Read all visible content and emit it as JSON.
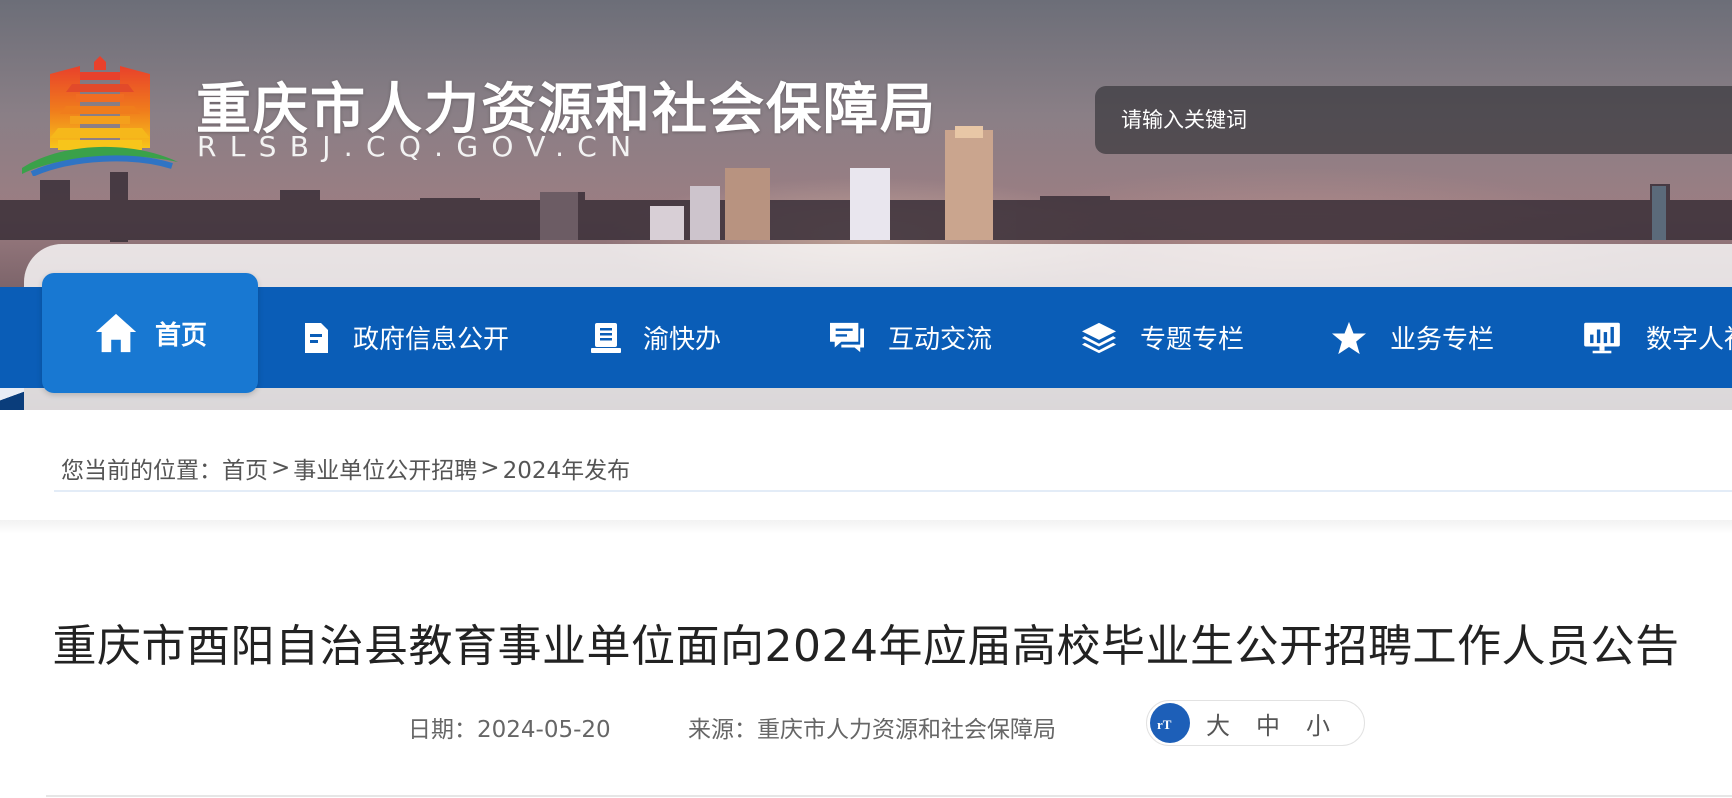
{
  "header": {
    "site_title": "重庆市人力资源和社会保障局",
    "site_domain": "RLSBJ.CQ.GOV.CN",
    "logo_icon": "temple-emblem-logo",
    "search": {
      "placeholder": "请输入关键词",
      "value": ""
    }
  },
  "nav": {
    "items": [
      {
        "label": "首页",
        "icon": "home-icon",
        "active": true
      },
      {
        "label": "政府信息公开",
        "icon": "document-icon",
        "active": false
      },
      {
        "label": "渝快办",
        "icon": "book-icon",
        "active": false
      },
      {
        "label": "互动交流",
        "icon": "chat-icon",
        "active": false
      },
      {
        "label": "专题专栏",
        "icon": "layers-icon",
        "active": false
      },
      {
        "label": "业务专栏",
        "icon": "star-icon",
        "active": false
      },
      {
        "label": "数字人社",
        "icon": "monitor-chart-icon",
        "active": false
      }
    ]
  },
  "breadcrumb": {
    "prefix": "您当前的位置：",
    "items": [
      "首页",
      "事业单位公开招聘",
      "2024年发布"
    ],
    "separator": ">"
  },
  "article": {
    "title": "重庆市酉阳自治县教育事业单位面向2024年应届高校毕业生公开招聘工作人员公告",
    "date": "日期：2024-05-20",
    "source": "来源：重庆市人力资源和社会保障局",
    "font_size": {
      "icon_text": "rT",
      "options": [
        "大",
        "中",
        "小"
      ]
    }
  },
  "colors": {
    "nav_bg": "#0a5db7",
    "nav_active_bg": "#1878d2",
    "title_text": "#222222",
    "meta_text": "#666666"
  }
}
